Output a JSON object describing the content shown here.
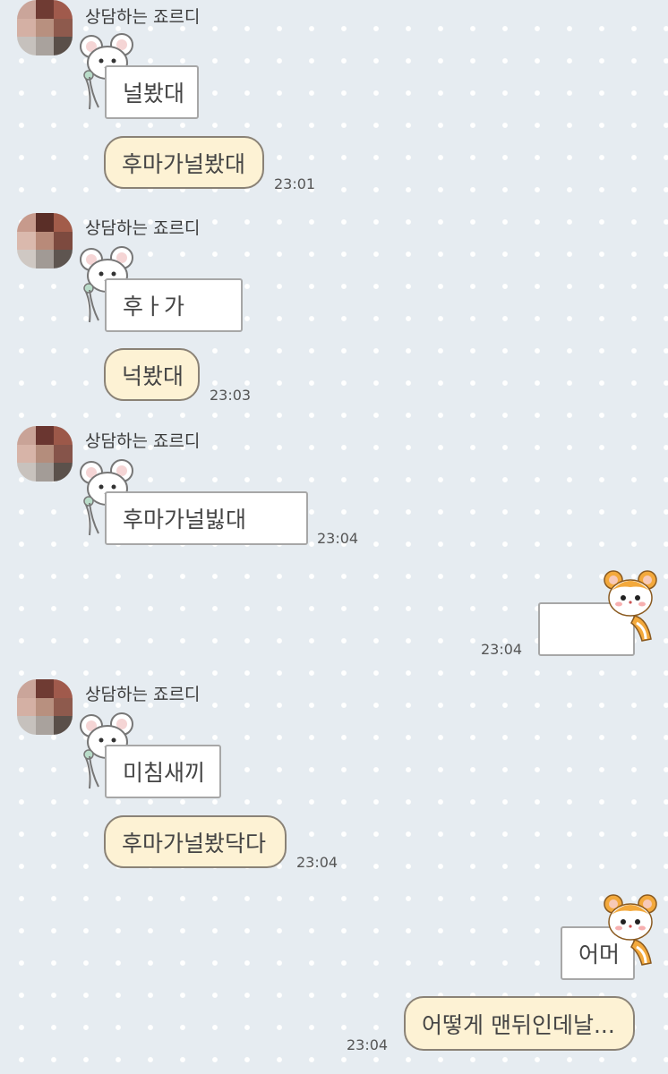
{
  "colors": {
    "background": "#e6ecf1",
    "dot": "#ffffff",
    "pill_bubble": "#fdf2d4",
    "pill_border": "#8a8276",
    "rect_bubble": "#ffffff",
    "rect_border": "#a7a7a7",
    "hamster_orange": "#f3a93c"
  },
  "chat": {
    "groups": [
      {
        "sender": "상담하는 죠르디",
        "messages": [
          {
            "style": "sticker-note",
            "text": "널봤대"
          },
          {
            "style": "pill",
            "text": "후마가널봤대",
            "time": "23:01"
          }
        ]
      },
      {
        "sender": "상담하는 죠르디",
        "messages": [
          {
            "style": "sticker-note",
            "text": "후ㅏ가"
          },
          {
            "style": "pill",
            "text": "넉봤대",
            "time": "23:03"
          }
        ]
      },
      {
        "sender": "상담하는 죠르디",
        "messages": [
          {
            "style": "sticker-note",
            "text": "후마가널빓대",
            "time": "23:04"
          }
        ]
      },
      {
        "sender": "me",
        "messages": [
          {
            "style": "sticker-note",
            "text": "",
            "time": "23:04"
          }
        ]
      },
      {
        "sender": "상담하는 죠르디",
        "messages": [
          {
            "style": "sticker-note",
            "text": "미침새끼"
          },
          {
            "style": "pill",
            "text": "후마가널봤닥다",
            "time": "23:04"
          }
        ]
      },
      {
        "sender": "me",
        "messages": [
          {
            "style": "sticker-note",
            "text": "어머"
          },
          {
            "style": "pill",
            "text": "어떻게 맨뒤인데날...",
            "time": "23:04"
          }
        ]
      }
    ]
  },
  "icons": {
    "avatar": "pixelated-profile-avatar",
    "other_sticker": "white-mouse-sticker",
    "my_sticker": "orange-hamster-sticker"
  }
}
